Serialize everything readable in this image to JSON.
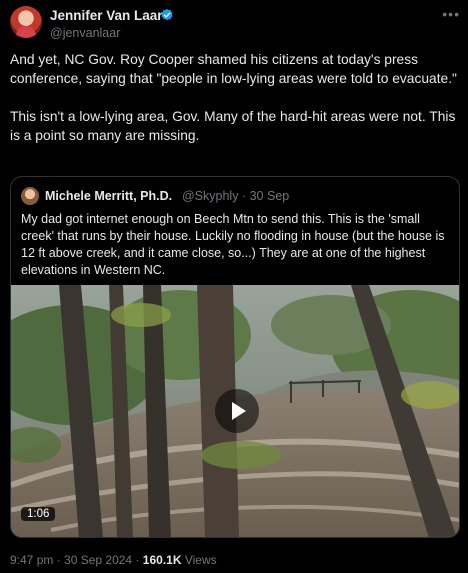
{
  "author": {
    "name": "Jennifer Van Laar",
    "handle": "@jenvanlaar",
    "verified_icon": "verified-badge-icon",
    "more_icon": "more-options-icon"
  },
  "tweet": {
    "paragraph_1": "And yet, NC Gov. Roy Cooper shamed his citizens at today's press conference, saying that \"people in low-lying areas were told to evacuate.\"",
    "paragraph_2": "This isn't a low-lying area, Gov. Many of the hard-hit areas were not. This is a point so many are missing."
  },
  "quoted": {
    "name": "Michele Merritt, Ph.D.",
    "handle": "@Skyphly",
    "separator": "·",
    "date": "30 Sep",
    "text": "My dad got internet enough on Beech Mtn to send this. This is the 'small creek' that runs by their house. Luckily no flooding in house (but the house is 12 ft above creek, and it came close, so...) They are at one of the highest elevations in Western NC.",
    "video": {
      "duration": "1:06",
      "play_icon": "play-icon"
    }
  },
  "footer": {
    "time": "9:47 pm",
    "separator": "·",
    "date": "30 Sep 2024",
    "views_count": "160.1K",
    "views_label": "Views"
  },
  "colors": {
    "background": "#000000",
    "text": "#e7e9ea",
    "secondary_text": "#71767b",
    "border": "#2f3336",
    "verified_blue": "#1d9bf0"
  }
}
